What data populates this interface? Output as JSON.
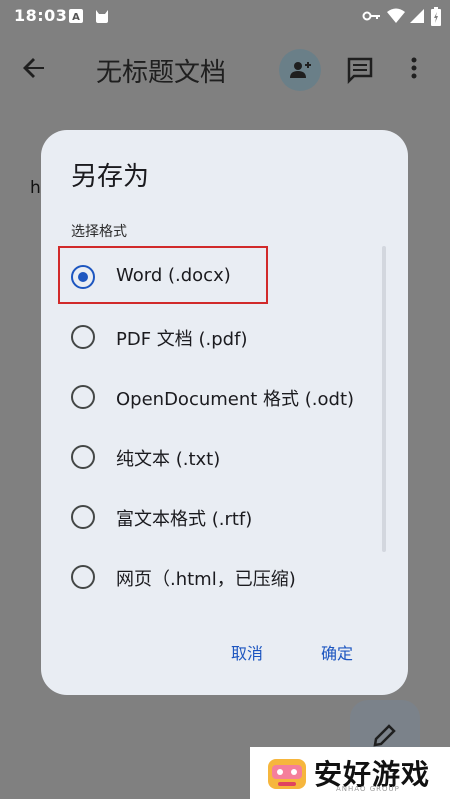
{
  "status_bar": {
    "time": "18:03",
    "icons": [
      "a-box-icon",
      "android-cat-icon",
      "vpn-key-icon",
      "wifi-icon",
      "signal-icon",
      "battery-icon"
    ]
  },
  "app_bar": {
    "title": "无标题文档",
    "icons": [
      "back-arrow-icon",
      "add-person-icon",
      "comment-icon",
      "more-vert-icon"
    ]
  },
  "document": {
    "text": "h"
  },
  "dialog": {
    "title": "另存为",
    "section_label": "选择格式",
    "options": [
      {
        "label": "Word (.docx)",
        "selected": true
      },
      {
        "label": "PDF 文档 (.pdf)",
        "selected": false
      },
      {
        "label": "OpenDocument 格式 (.odt)",
        "selected": false
      },
      {
        "label": "纯文本 (.txt)",
        "selected": false
      },
      {
        "label": "富文本格式 (.rtf)",
        "selected": false
      },
      {
        "label": "网页（.html，已压缩)",
        "selected": false
      }
    ],
    "cancel_label": "取消",
    "confirm_label": "确定"
  },
  "watermark": {
    "brand": "安好游戏",
    "tagline": "ANHAO GROUP"
  },
  "colors": {
    "accent": "#1d56c0",
    "dialog_bg": "#e9edf3",
    "scrim": "#808080",
    "highlight": "#d12a2a"
  }
}
